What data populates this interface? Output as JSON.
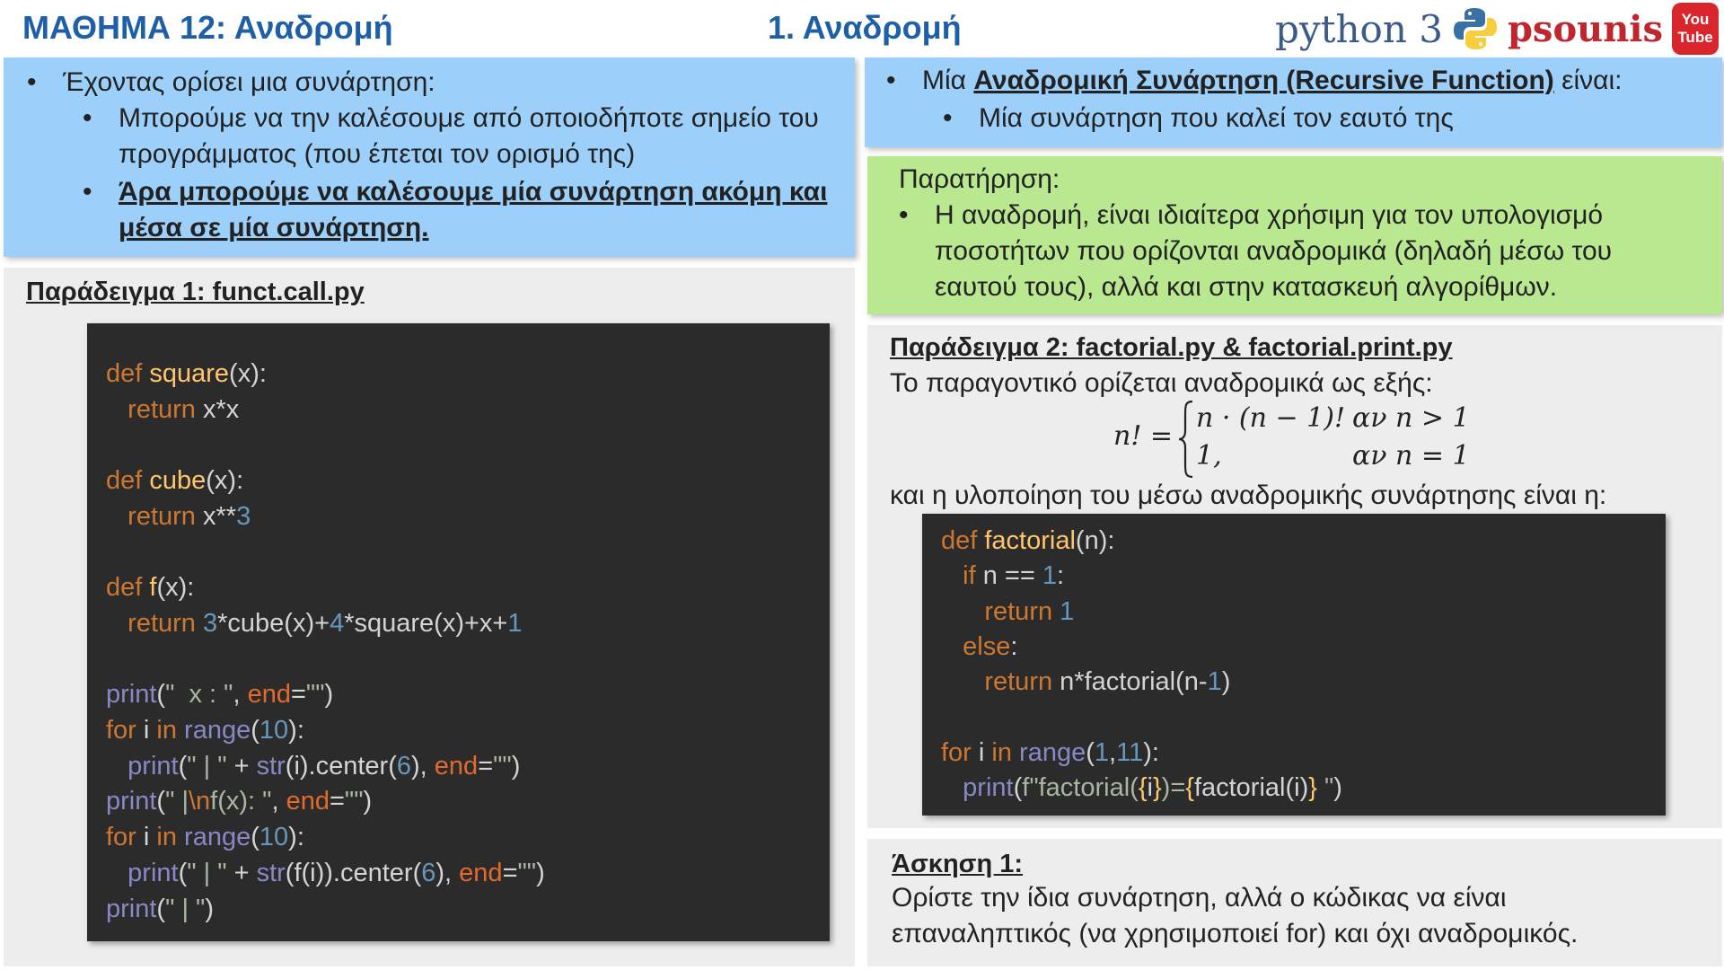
{
  "header": {
    "lesson_title": "ΜΑΘΗΜΑ 12: Αναδρομή",
    "slide_title": "1. Αναδρομή",
    "brand_python": "python 3",
    "brand_psounis": "psounis",
    "youtube_top": "You",
    "youtube_bottom": "Tube"
  },
  "intro": {
    "line1": "Έχοντας ορίσει μια συνάρτηση:",
    "line2a": "Μπορούμε να την καλέσουμε από οποιοδήποτε σημείο του",
    "line2b": "προγράμματος (που έπεται τον ορισμό της)",
    "line3a": "Άρα μπορούμε να καλέσουμε μία συνάρτηση ακόμη και",
    "line3b": "μέσα σε μία συνάρτηση."
  },
  "definition": {
    "prefix": "Μία ",
    "term": "Αναδρομική Συνάρτηση (Recursive Function)",
    "suffix": " είναι:",
    "line2": "Μία συνάρτηση που καλεί τον εαυτό της"
  },
  "note": {
    "heading": "Παρατήρηση:",
    "line1": "Η αναδρομή, είναι ιδιαίτερα χρήσιμη για τον υπολογισμό",
    "line2": "ποσοτήτων που ορίζονται αναδρομικά (δηλαδή μέσω του",
    "line3": "εαυτού τους), αλλά και στην κατασκευή αλγορίθμων."
  },
  "example1": {
    "heading": "Παράδειγμα 1: funct.call.py",
    "code": [
      [
        [
          "kw",
          "def "
        ],
        [
          "fn",
          "square"
        ],
        [
          "pl",
          "(x):"
        ]
      ],
      [
        [
          "pl",
          "   "
        ],
        [
          "kw",
          "return "
        ],
        [
          "pl",
          "x*x"
        ]
      ],
      [],
      [
        [
          "kw",
          "def "
        ],
        [
          "fn",
          "cube"
        ],
        [
          "pl",
          "(x):"
        ]
      ],
      [
        [
          "pl",
          "   "
        ],
        [
          "kw",
          "return "
        ],
        [
          "pl",
          "x**"
        ],
        [
          "num",
          "3"
        ]
      ],
      [],
      [
        [
          "kw",
          "def "
        ],
        [
          "fn",
          "f"
        ],
        [
          "pl",
          "(x):"
        ]
      ],
      [
        [
          "pl",
          "   "
        ],
        [
          "kw",
          "return "
        ],
        [
          "num",
          "3"
        ],
        [
          "pl",
          "*cube(x)+"
        ],
        [
          "num",
          "4"
        ],
        [
          "pl",
          "*square(x)+x+"
        ],
        [
          "num",
          "1"
        ]
      ],
      [],
      [
        [
          "bi",
          "print"
        ],
        [
          "pl",
          "("
        ],
        [
          "str",
          "\"  x : \""
        ],
        [
          "pl",
          ", "
        ],
        [
          "prm",
          "end"
        ],
        [
          "pl",
          "="
        ],
        [
          "str",
          "\"\""
        ],
        [
          "pl",
          ")"
        ]
      ],
      [
        [
          "kw",
          "for "
        ],
        [
          "pl",
          "i "
        ],
        [
          "kw",
          "in "
        ],
        [
          "bi",
          "range"
        ],
        [
          "pl",
          "("
        ],
        [
          "num",
          "10"
        ],
        [
          "pl",
          "):"
        ]
      ],
      [
        [
          "pl",
          "   "
        ],
        [
          "bi",
          "print"
        ],
        [
          "pl",
          "("
        ],
        [
          "str",
          "\" | \""
        ],
        [
          "pl",
          " + "
        ],
        [
          "bi",
          "str"
        ],
        [
          "pl",
          "(i).center("
        ],
        [
          "num",
          "6"
        ],
        [
          "pl",
          "), "
        ],
        [
          "prm",
          "end"
        ],
        [
          "pl",
          "="
        ],
        [
          "str",
          "\"\""
        ],
        [
          "pl",
          ")"
        ]
      ],
      [
        [
          "bi",
          "print"
        ],
        [
          "pl",
          "("
        ],
        [
          "str",
          "\" |"
        ],
        [
          "kw",
          "\\n"
        ],
        [
          "str",
          "f(x): \""
        ],
        [
          "pl",
          ", "
        ],
        [
          "prm",
          "end"
        ],
        [
          "pl",
          "="
        ],
        [
          "str",
          "\"\""
        ],
        [
          "pl",
          ")"
        ]
      ],
      [
        [
          "kw",
          "for "
        ],
        [
          "pl",
          "i "
        ],
        [
          "kw",
          "in "
        ],
        [
          "bi",
          "range"
        ],
        [
          "pl",
          "("
        ],
        [
          "num",
          "10"
        ],
        [
          "pl",
          "):"
        ]
      ],
      [
        [
          "pl",
          "   "
        ],
        [
          "bi",
          "print"
        ],
        [
          "pl",
          "("
        ],
        [
          "str",
          "\" | \""
        ],
        [
          "pl",
          " + "
        ],
        [
          "bi",
          "str"
        ],
        [
          "pl",
          "(f(i)).center("
        ],
        [
          "num",
          "6"
        ],
        [
          "pl",
          "), "
        ],
        [
          "prm",
          "end"
        ],
        [
          "pl",
          "="
        ],
        [
          "str",
          "\"\""
        ],
        [
          "pl",
          ")"
        ]
      ],
      [
        [
          "bi",
          "print"
        ],
        [
          "pl",
          "("
        ],
        [
          "str",
          "\" | \""
        ],
        [
          "pl",
          ")"
        ]
      ]
    ]
  },
  "example2": {
    "heading": "Παράδειγμα 2: factorial.py & factorial.print.py",
    "line1": "Το παραγοντικό ορίζεται αναδρομικά ως εξής:",
    "formula": {
      "lhs": "n! =",
      "case1_expr": "n · (n − 1)!",
      "case1_cond": "αν n > 1",
      "case2_expr": "1,",
      "case2_cond": "αν n = 1"
    },
    "line2": "και η υλοποίηση του μέσω αναδρομικής συνάρτησης είναι η:",
    "code": [
      [
        [
          "kw",
          "def "
        ],
        [
          "fn",
          "factorial"
        ],
        [
          "pl",
          "(n):"
        ]
      ],
      [
        [
          "pl",
          "   "
        ],
        [
          "kw",
          "if "
        ],
        [
          "pl",
          "n == "
        ],
        [
          "num",
          "1"
        ],
        [
          "pl",
          ":"
        ]
      ],
      [
        [
          "pl",
          "      "
        ],
        [
          "kw",
          "return "
        ],
        [
          "num",
          "1"
        ]
      ],
      [
        [
          "pl",
          "   "
        ],
        [
          "kw",
          "else"
        ],
        [
          "pl",
          ":"
        ]
      ],
      [
        [
          "pl",
          "      "
        ],
        [
          "kw",
          "return "
        ],
        [
          "pl",
          "n*factorial(n-"
        ],
        [
          "num",
          "1"
        ],
        [
          "pl",
          ")"
        ]
      ],
      [],
      [
        [
          "kw",
          "for "
        ],
        [
          "pl",
          "i "
        ],
        [
          "kw",
          "in "
        ],
        [
          "bi",
          "range"
        ],
        [
          "pl",
          "("
        ],
        [
          "num",
          "1"
        ],
        [
          "pl",
          ","
        ],
        [
          "num",
          "11"
        ],
        [
          "pl",
          "):"
        ]
      ],
      [
        [
          "pl",
          "   "
        ],
        [
          "bi",
          "print"
        ],
        [
          "pl",
          "("
        ],
        [
          "str",
          "f\"factorial("
        ],
        [
          "fn",
          "{"
        ],
        [
          "pl",
          "i"
        ],
        [
          "fn",
          "}"
        ],
        [
          "str",
          ")="
        ],
        [
          "fn",
          "{"
        ],
        [
          "pl",
          "factorial(i)"
        ],
        [
          "fn",
          "}"
        ],
        [
          "str",
          " \""
        ],
        [
          "pl",
          ")"
        ]
      ]
    ]
  },
  "exercise": {
    "heading": "Άσκηση 1:",
    "line1": "Ορίστε την ίδια συνάρτηση, αλλά ο κώδικας να είναι",
    "line2": "επαναληπτικός (να χρησιμοποιεί for) και όχι αναδρομικός."
  },
  "colors": {
    "title_blue": "#1f5fa8",
    "panel_blue": "#9cd0fb",
    "panel_green": "#b9e890",
    "panel_gray": "#ededed",
    "code_bg": "#2b2b2b",
    "keyword": "#cc7832",
    "function": "#ffc66d",
    "number": "#6897bb",
    "builtin": "#8888c6",
    "string": "#a9b7a2",
    "param": "#e26a2b"
  },
  "icons": [
    "python-logo-icon",
    "youtube-icon"
  ]
}
